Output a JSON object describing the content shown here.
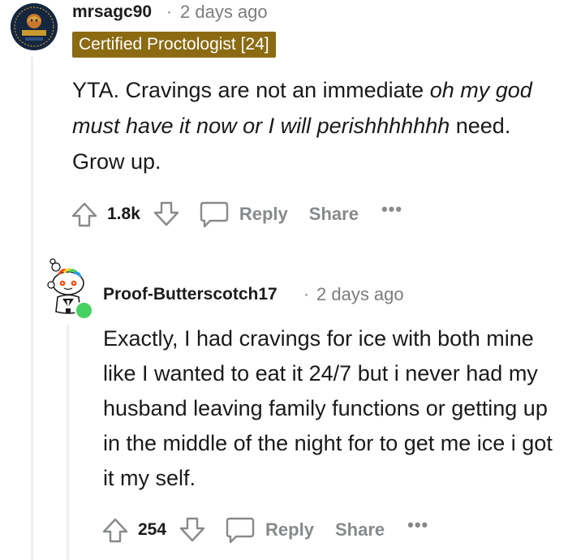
{
  "comments": [
    {
      "username": "mrsagc90",
      "separator": "·",
      "timestamp": "2 days ago",
      "flair": "Certified Proctologist [24]",
      "avatar_icon": "woman-inherits-earth-avatar-icon",
      "avatar_text": "WOMAN INHERITS THE EARTH",
      "body": {
        "part1": "YTA. Cravings are not an immediate ",
        "italic": "oh my god must have it now or I will perishhhhhhh",
        "part2": " need. Grow up."
      },
      "votes": "1.8k",
      "reply_label": "Reply",
      "share_label": "Share",
      "more_label": "•••"
    },
    {
      "username": "Proof-Butterscotch17",
      "separator": "·",
      "timestamp": "2 days ago",
      "avatar_icon": "snoo-avatar-icon",
      "online": true,
      "body": "Exactly, I had cravings for ice with both mine like I wanted to eat it 24/7 but i never had my husband leaving family functions or getting up in the middle of the night for to get me ice i got it my self.",
      "votes": "254",
      "reply_label": "Reply",
      "share_label": "Share",
      "more_label": "•••"
    }
  ],
  "colors": {
    "flair_bg": "#8b6a12",
    "meta_gray": "#7c7c7c",
    "action_gray": "#878a8c",
    "thread_line": "#edeff1",
    "online_green": "#46d160"
  }
}
